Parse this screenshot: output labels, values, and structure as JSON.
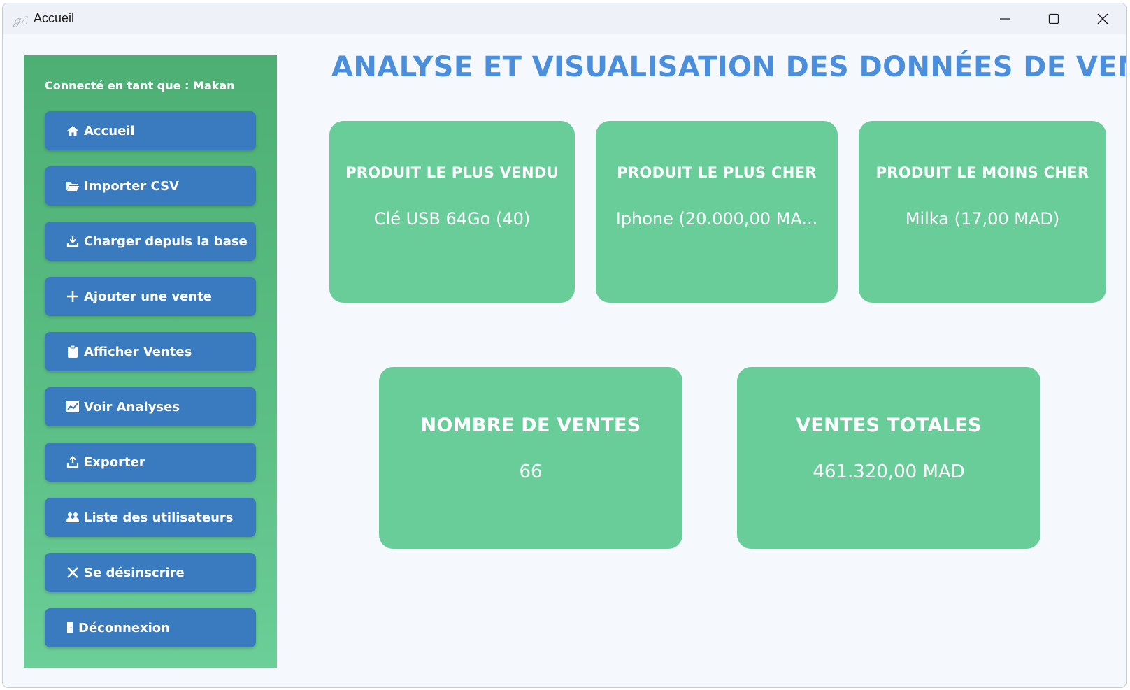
{
  "window": {
    "title": "Accueil"
  },
  "sidebar": {
    "connected_label": "Connecté en tant que : Makan",
    "items": [
      {
        "label": "Accueil",
        "icon": "home-icon"
      },
      {
        "label": "Importer CSV",
        "icon": "folder-icon"
      },
      {
        "label": "Charger depuis la base",
        "icon": "download-icon"
      },
      {
        "label": "Ajouter une vente",
        "icon": "plus-icon"
      },
      {
        "label": "Afficher Ventes",
        "icon": "clipboard-icon"
      },
      {
        "label": "Voir Analyses",
        "icon": "chart-icon"
      },
      {
        "label": "Exporter",
        "icon": "upload-icon"
      },
      {
        "label": "Liste des utilisateurs",
        "icon": "users-icon"
      },
      {
        "label": "Se désinscrire",
        "icon": "close-icon"
      },
      {
        "label": "Déconnexion",
        "icon": "door-icon"
      }
    ]
  },
  "main": {
    "title": "ANALYSE ET VISUALISATION DES DONNÉES DE VENTES",
    "cards": [
      {
        "label": "PRODUIT LE PLUS VENDU",
        "value": "Clé USB 64Go (40)"
      },
      {
        "label": "PRODUIT LE PLUS CHER",
        "value": "Iphone (20.000,00 MA..."
      },
      {
        "label": "PRODUIT LE MOINS CHER",
        "value": "Milka (17,00 MAD)"
      },
      {
        "label": "NOMBRE DE VENTES",
        "value": "66"
      },
      {
        "label": "VENTES TOTALES",
        "value": "461.320,00 MAD"
      }
    ]
  },
  "colors": {
    "sidebar_green": "#4daf73",
    "button_blue": "#3a7abf",
    "card_green": "#68cd99",
    "title_blue": "#4a8edc"
  }
}
